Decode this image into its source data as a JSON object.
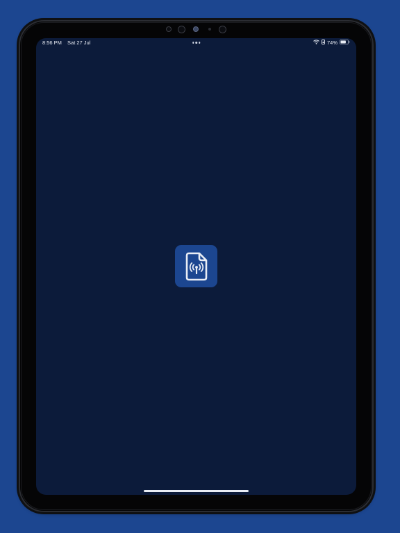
{
  "status_bar": {
    "time": "8:56 PM",
    "date": "Sat 27 Jul",
    "battery_percent": "74%",
    "battery_level": 0.74,
    "icons": [
      "wifi-icon",
      "lock-rotation-icon",
      "battery-icon"
    ]
  },
  "app_icon": {
    "icon": "document-broadcast-icon"
  },
  "colors": {
    "background": "#1c4690",
    "screen": "#0c1b3a",
    "icon_tile": "#1c4690",
    "device_frame": "#050506"
  }
}
